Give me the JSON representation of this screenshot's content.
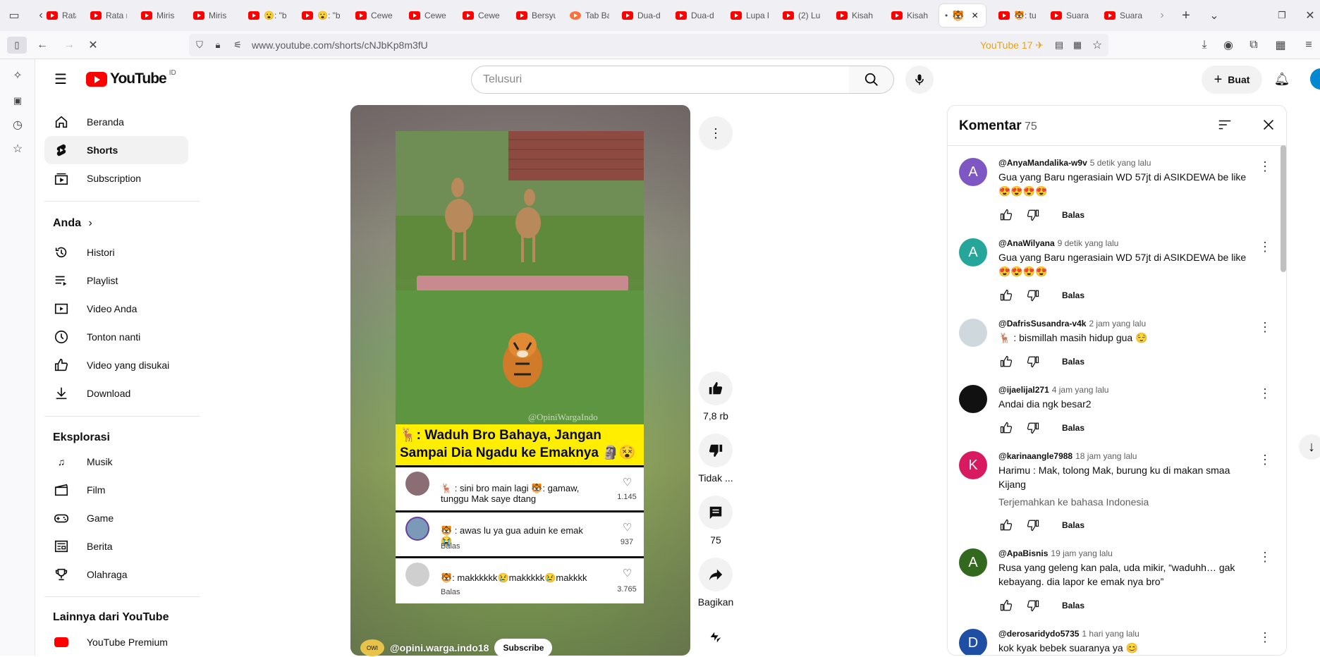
{
  "browser": {
    "tabs": [
      {
        "label": "Rata r"
      },
      {
        "label": "Rata r"
      },
      {
        "label": "Miris"
      },
      {
        "label": "Miris"
      },
      {
        "label": "😮: \"b"
      },
      {
        "label": "😮: \"b"
      },
      {
        "label": "Cewe"
      },
      {
        "label": "Cewe"
      },
      {
        "label": "Cewe"
      },
      {
        "label": "Bersyu"
      },
      {
        "label": "Tab Ba"
      },
      {
        "label": "Dua-d"
      },
      {
        "label": "Dua-d"
      },
      {
        "label": "Lupa k"
      },
      {
        "label": "(2) Lu"
      },
      {
        "label": "Kisah"
      },
      {
        "label": "Kisah"
      },
      {
        "label": "•"
      },
      {
        "label": "🐯: tu"
      },
      {
        "label": "Suara"
      },
      {
        "label": "Suara"
      }
    ],
    "url": "www.youtube.com/shorts/cNJbKp8m3fU",
    "badge": "YouTube 17"
  },
  "youtube": {
    "logo_text": "YouTube",
    "country": "ID",
    "search_placeholder": "Telusuri",
    "create_label": "Buat",
    "sidebar": {
      "main": [
        {
          "label": "Beranda",
          "icon": "home-icon"
        },
        {
          "label": "Shorts",
          "icon": "shorts-icon",
          "active": true
        },
        {
          "label": "Subscription",
          "icon": "subscription-icon"
        }
      ],
      "you_heading": "Anda",
      "you": [
        {
          "label": "Histori",
          "icon": "history-icon"
        },
        {
          "label": "Playlist",
          "icon": "playlist-icon"
        },
        {
          "label": "Video Anda",
          "icon": "your-videos-icon"
        },
        {
          "label": "Tonton nanti",
          "icon": "watch-later-icon"
        },
        {
          "label": "Video yang disukai",
          "icon": "liked-icon"
        },
        {
          "label": "Download",
          "icon": "download-icon"
        }
      ],
      "explore_heading": "Eksplorasi",
      "explore": [
        {
          "label": "Musik",
          "icon": "music-icon"
        },
        {
          "label": "Film",
          "icon": "film-icon"
        },
        {
          "label": "Game",
          "icon": "game-icon"
        },
        {
          "label": "Berita",
          "icon": "news-icon"
        },
        {
          "label": "Olahraga",
          "icon": "trophy-icon"
        }
      ],
      "more_heading": "Lainnya dari YouTube",
      "more": [
        {
          "label": "YouTube Premium",
          "icon": "youtube-premium-icon"
        }
      ]
    }
  },
  "short": {
    "watermark": "@OpiniWargaIndo",
    "overlay_title": "🦌: Waduh Bro Bahaya, Jangan Sampai Dia Ngadu ke Emaknya 🗿😵",
    "overlay_comments": [
      {
        "text": "🦌 : sini bro main lagi 🐯: gamaw, tunggu Mak saye dtang",
        "sub": "",
        "likes": "1.145"
      },
      {
        "text": "🐯 : awas lu ya gua aduin ke emak 😭",
        "sub": "Balas",
        "likes": "937"
      },
      {
        "text": "🐯: makkkkkk😢makkkkk😢makkkk",
        "sub": "Balas",
        "likes": "3.765"
      }
    ],
    "channel_name": "@opini.warga.indo18",
    "subscribe_label": "Subscribe",
    "like_count": "7,8 rb",
    "dislike_label": "Tidak ...",
    "comment_count": "75",
    "share_label": "Bagikan"
  },
  "comments_panel": {
    "title": "Komentar",
    "count": "75",
    "reply_label": "Balas",
    "translate_label": "Terjemahkan ke bahasa Indonesia",
    "items": [
      {
        "initial": "A",
        "color": "#7e57c2",
        "user": "@AnyaMandalika-w9v",
        "time": "5 detik yang lalu",
        "text": "Gua yang Baru ngerasiain WD 57jt di ASIKDEWA be like 😍😍😍😍"
      },
      {
        "initial": "A",
        "color": "#26a69a",
        "user": "@AnaWilyana",
        "time": "9 detik yang lalu",
        "text": "Gua yang Baru ngerasiain WD 57jt di ASIKDEWA be like 😍😍😍😍"
      },
      {
        "initial": "",
        "color": "#cfd8dc",
        "user": "@DafrisSusandra-v4k",
        "time": "2 jam yang lalu",
        "text": "🦌 : bismillah masih hidup gua 😌"
      },
      {
        "initial": "",
        "color": "#111111",
        "user": "@ijaelijal271",
        "time": "4 jam yang lalu",
        "text": "Andai dia ngk besar2"
      },
      {
        "initial": "K",
        "color": "#d81b60",
        "user": "@karinaangle7988",
        "time": "18 jam yang lalu",
        "text": "Harimu : Mak, tolong Mak, burung ku di makan smaa Kijang"
      },
      {
        "initial": "A",
        "color": "#33691e",
        "user": "@ApaBisnis",
        "time": "19 jam yang lalu",
        "text": "Rusa yang geleng kan pala, uda mikir, “waduhh… gak kebayang. dia lapor ke emak nya bro”"
      },
      {
        "initial": "D",
        "color": "#1e4fa3",
        "user": "@derosaridydo5735",
        "time": "1 hari yang lalu",
        "text": "kok kyak bebek suaranya ya 😊"
      }
    ]
  }
}
